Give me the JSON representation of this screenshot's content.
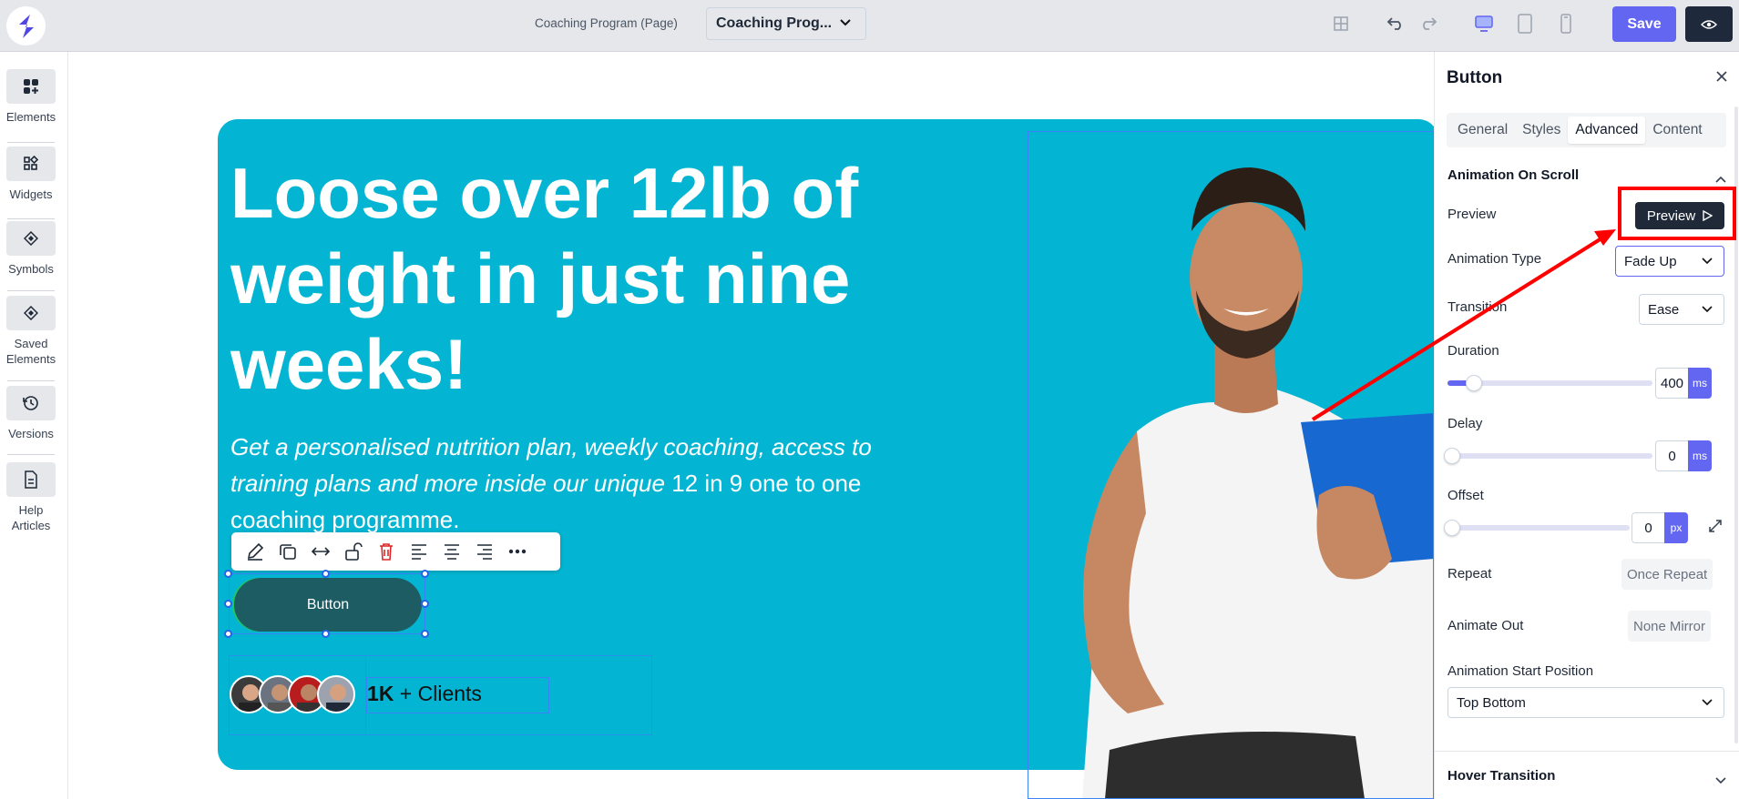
{
  "topbar": {
    "page_name": "Coaching Program (Page)",
    "page_select_value": "Coaching Prog...",
    "save_label": "Save"
  },
  "sidebar": {
    "items": [
      {
        "label": "Elements",
        "icon": "elements-icon"
      },
      {
        "label": "Widgets",
        "icon": "widgets-icon"
      },
      {
        "label": "Symbols",
        "icon": "symbols-icon"
      },
      {
        "label": "Saved Elements",
        "icon": "saved-elements-icon"
      },
      {
        "label": "Versions",
        "icon": "history-icon"
      },
      {
        "label": "Help Articles",
        "icon": "document-icon"
      }
    ]
  },
  "canvas": {
    "headline": "Loose over 12lb of weight in just nine weeks!",
    "subtext_italic": "Get a personalised nutrition plan, weekly coaching, access to training plans and more inside our unique",
    "subtext_plain": " 12 in 9 one to one coaching programme.",
    "button_label": "Button",
    "clients_count": "1K",
    "clients_suffix": " + Clients"
  },
  "panel": {
    "title": "Button",
    "tabs": [
      "General",
      "Styles",
      "Advanced",
      "Content"
    ],
    "active_tab": "Advanced",
    "section_title": "Animation On Scroll",
    "preview_label": "Preview",
    "preview_button": "Preview",
    "animation_type_label": "Animation Type",
    "animation_type_value": "Fade Up",
    "transition_label": "Transition",
    "transition_value": "Ease",
    "duration_label": "Duration",
    "duration_value": "400",
    "duration_unit": "ms",
    "duration_fraction": 0.13,
    "delay_label": "Delay",
    "delay_value": "0",
    "delay_unit": "ms",
    "offset_label": "Offset",
    "offset_value": "0",
    "offset_unit": "px",
    "repeat_label": "Repeat",
    "repeat_options": [
      "Once",
      "Repeat"
    ],
    "animate_out_label": "Animate Out",
    "animate_out_options": [
      "None",
      "Mirror"
    ],
    "start_position_label": "Animation Start Position",
    "start_position_value": "Top Bottom",
    "hover_section_title": "Hover Transition"
  },
  "colors": {
    "hero_bg": "#03b5d2",
    "accent": "#6366f1",
    "button_bg": "#1d5c63",
    "annotation": "#ff0000"
  }
}
